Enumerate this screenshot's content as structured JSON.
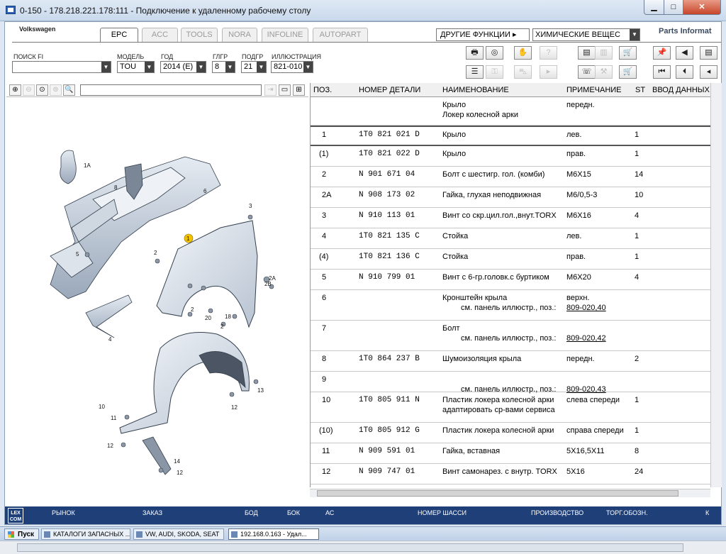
{
  "window": {
    "title": "0-150 - 178.218.221.178:111 - Подключение к удаленному рабочему столу",
    "min": "▁",
    "max": "□",
    "close": "✕"
  },
  "app": {
    "brand": "Volkswagen",
    "parts_brand": "Parts Informat",
    "tabs": [
      "EPC",
      "ACC",
      "TOOLS",
      "NORA",
      "INFOLINE",
      "AUTOPART"
    ],
    "active_tab": "EPC",
    "other_functions": "ДРУГИЕ ФУНКЦИИ ▸",
    "chem_dropdown": "ХИМИЧЕСКИЕ ВЕЩЕС"
  },
  "filters": {
    "search_fi": {
      "label": "ПОИСК FI",
      "value": ""
    },
    "model": {
      "label": "МОДЕЛЬ",
      "value": "TOU"
    },
    "year": {
      "label": "ГОД",
      "value": "2014 (E)"
    },
    "glgr": {
      "label": "ГЛГР",
      "value": "8"
    },
    "podgr": {
      "label": "ПОДГР",
      "value": "21"
    },
    "illustration": {
      "label": "ИЛЛЮСТРАЦИЯ",
      "value": "821-010"
    }
  },
  "toolbar": [
    {
      "name": "print-icon",
      "glyph": "🖶"
    },
    {
      "name": "disc-icon",
      "glyph": "◎"
    },
    {
      "name": "handshake-icon",
      "glyph": "✋"
    },
    {
      "name": "question-icon",
      "glyph": "?",
      "dim": true
    },
    {
      "name": "elsa-icon",
      "glyph": "▤"
    },
    {
      "name": "dsa-icon",
      "glyph": "▥",
      "dim": true
    },
    {
      "name": "cart-add-icon",
      "glyph": "🛒"
    },
    {
      "name": "pin-icon",
      "glyph": "📌"
    },
    {
      "name": "book-back-icon",
      "glyph": "◀"
    },
    {
      "name": "book-icon",
      "glyph": "▤"
    },
    {
      "name": "list-icon",
      "glyph": "☰"
    },
    {
      "name": "key-icon",
      "glyph": "⚿",
      "dim": true
    },
    {
      "name": "car-icon",
      "glyph": "⛍",
      "dim": true
    },
    {
      "name": "play-dash-icon",
      "glyph": "▸",
      "dim": true
    },
    {
      "name": "phone-icon",
      "glyph": "☏"
    },
    {
      "name": "repair-icon",
      "glyph": "⚒",
      "dim": true
    },
    {
      "name": "cart-icon",
      "glyph": "🛒"
    },
    {
      "name": "first-icon",
      "glyph": "⏮"
    },
    {
      "name": "prev-icon",
      "glyph": "⏴"
    },
    {
      "name": "back-icon",
      "glyph": "◂"
    }
  ],
  "ill_tools": [
    {
      "name": "zoom-in-icon",
      "glyph": "⊕"
    },
    {
      "name": "zoom-out-icon",
      "glyph": "⊖",
      "dim": true
    },
    {
      "name": "zoom-fit-icon",
      "glyph": "⊙"
    },
    {
      "name": "zoom-reset-icon",
      "glyph": "⊚",
      "dim": true
    },
    {
      "name": "magnifier-icon",
      "glyph": "🔍"
    }
  ],
  "ill_right_tools": [
    {
      "name": "export-icon",
      "glyph": "⇥",
      "dim": true
    },
    {
      "name": "window-icon",
      "glyph": "▭"
    },
    {
      "name": "split-icon",
      "glyph": "⊞"
    }
  ],
  "illustration": {
    "labels": [
      "1",
      "1A",
      "2",
      "2",
      "2",
      "2A",
      "2B",
      "3",
      "4",
      "5",
      "6",
      "8",
      "10",
      "11",
      "12",
      "12",
      "12",
      "13",
      "14",
      "18",
      "20"
    ]
  },
  "table": {
    "columns": [
      "ПОЗ.",
      "НОМЕР ДЕТАЛИ",
      "НАИМЕНОВАНИЕ",
      "ПРИМЕЧАНИЕ",
      "ST",
      "ВВОД ДАННЫХ"
    ],
    "rows": [
      {
        "pos": "",
        "part": "",
        "name": "Крыло",
        "name2": "Локер колесной арки",
        "note": "передн.",
        "st": ""
      },
      {
        "pos": "1",
        "part": "1T0  821  021  D",
        "name": "Крыло",
        "note": "лев.",
        "st": "1"
      },
      {
        "pos": "(1)",
        "part": "1T0  821  022  D",
        "name": "Крыло",
        "note": "прав.",
        "st": "1"
      },
      {
        "pos": "2",
        "part": "N    901  671  04",
        "name": "Болт с шестигр. гол. (комби)",
        "note": "M6X15",
        "st": "14"
      },
      {
        "pos": "2A",
        "part": "N    908  173  02",
        "name": "Гайка, глухая неподвижная",
        "note": "M6/0,5-3",
        "st": "10"
      },
      {
        "pos": "3",
        "part": "N    910  113  01",
        "name": "Винт со скр.цил.гол.,внут.TORX",
        "note": "M6X16",
        "st": "4"
      },
      {
        "pos": "4",
        "part": "1T0  821  135  C",
        "name": "Стойка",
        "note": "лев.",
        "st": "1"
      },
      {
        "pos": "(4)",
        "part": "1T0  821  136  C",
        "name": "Стойка",
        "note": "прав.",
        "st": "1"
      },
      {
        "pos": "5",
        "part": "N    910  799  01",
        "name": "Винт с 6-гр.головк.с буртиком",
        "note": "M6X20",
        "st": "4"
      },
      {
        "pos": "6",
        "part": "",
        "name": "Кронштейн крыла",
        "name2": "см. панель иллюстр., поз.:",
        "note": "верхн.",
        "link": "809-020,40",
        "st": ""
      },
      {
        "pos": "7",
        "part": "",
        "name": "Болт",
        "name2": "см. панель иллюстр., поз.:",
        "note": "",
        "link": "809-020,42",
        "st": ""
      },
      {
        "pos": "8",
        "part": "1T0  864  237  B",
        "name": "Шумоизоляция крыла",
        "note": "передн.",
        "st": "2"
      },
      {
        "pos": "9",
        "part": "",
        "name": "",
        "name2": "см. панель иллюстр., поз.:",
        "note": "",
        "link": "809-020,43",
        "st": ""
      },
      {
        "pos": "10",
        "part": "1T0  805  911  N",
        "name": "Пластик локера колесной арки",
        "name2": "адаптировать ср-вами сервиса",
        "note": "слева спереди",
        "st": "1"
      },
      {
        "pos": "(10)",
        "part": "1T0  805  912  G",
        "name": "Пластик локера колесной арки",
        "note": "справа спереди",
        "st": "1"
      },
      {
        "pos": "11",
        "part": "N    909  591  01",
        "name": "Гайка, вставная",
        "note": "5X16,5X11",
        "st": "8"
      },
      {
        "pos": "12",
        "part": "N    909  747  01",
        "name": "Винт самонарез. с внутр. TORX",
        "note": "5X16",
        "st": "24"
      }
    ]
  },
  "statusbar": {
    "logo": "LEX COM",
    "items": [
      "РЫНОК",
      "ЗАКАЗ",
      "БОД",
      "БОК",
      "АС",
      "НОМЕР ШАССИ",
      "ПРОИЗВОДСТВО",
      "ТОРГ.ОБОЗН.",
      "К"
    ]
  },
  "taskbar": {
    "start": "Пуск",
    "tasks": [
      "КАТАЛОГИ ЗАПАСНЫХ ...",
      "VW, AUDI, SKODA, SEAT",
      "192.168.0.163 - Удал..."
    ]
  },
  "colors": {
    "statusbar": "#1e3f78",
    "callout": "#f2c200"
  }
}
